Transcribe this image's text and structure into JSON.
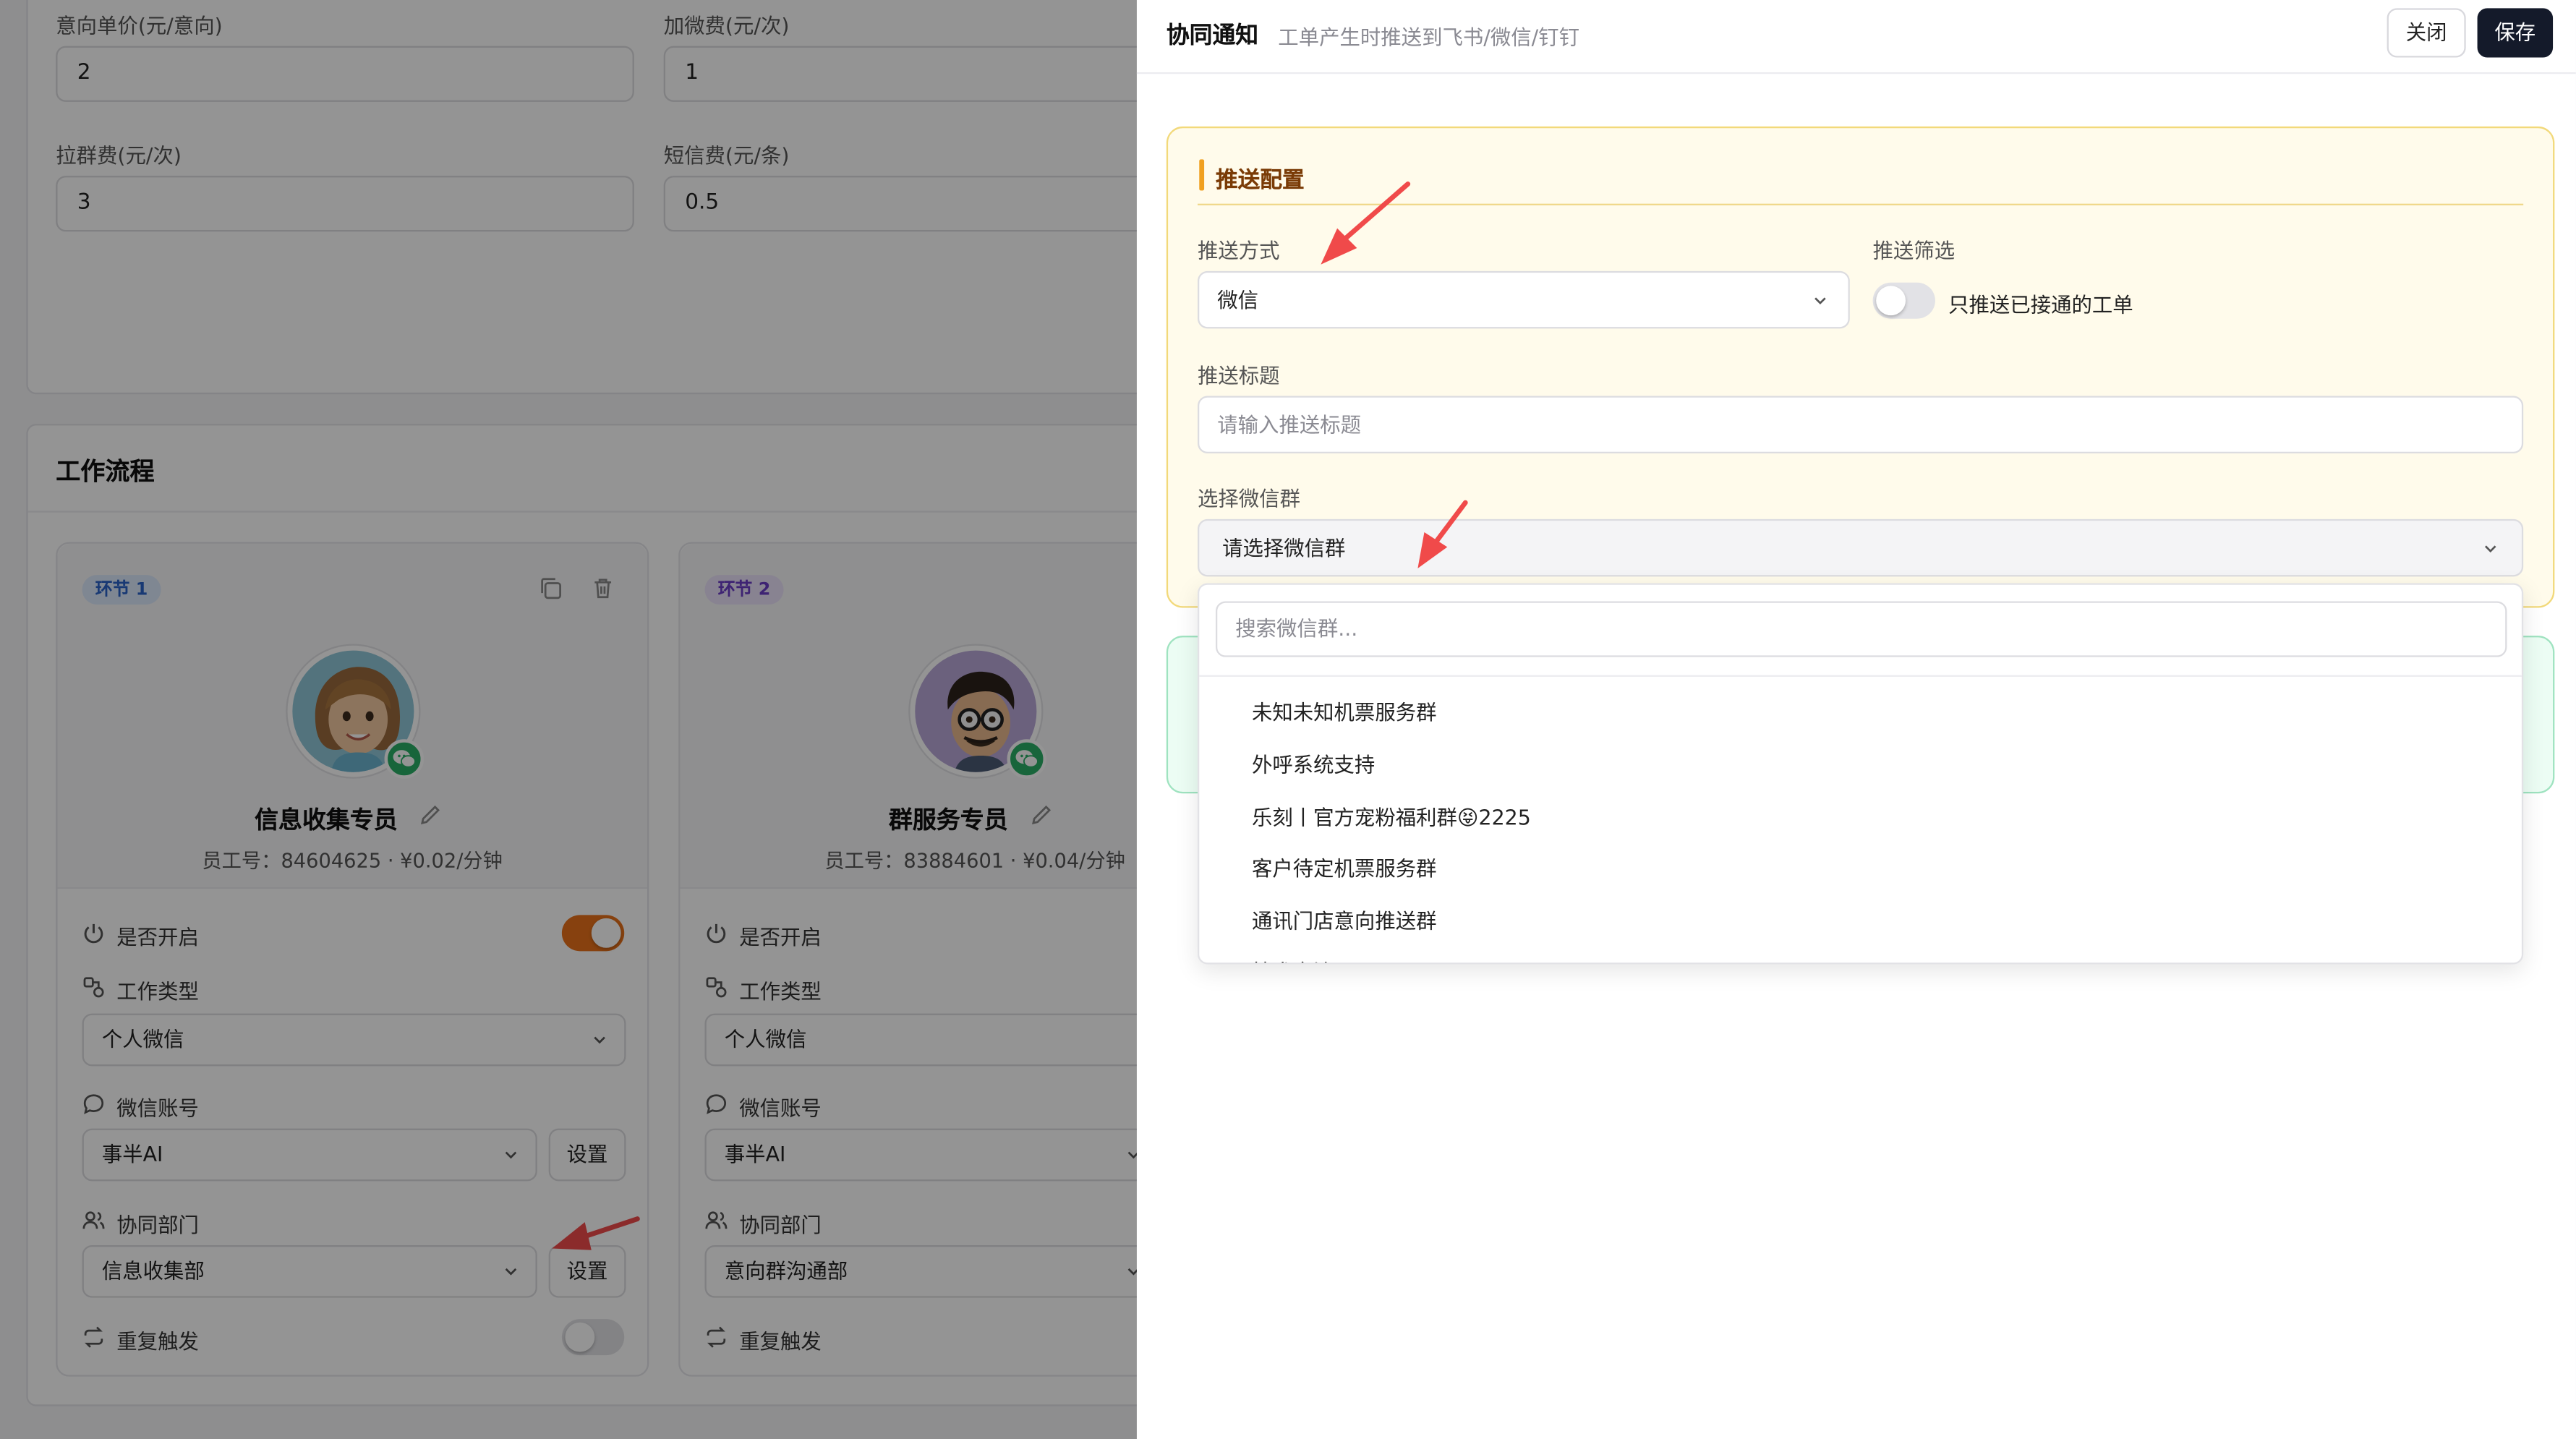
{
  "background_page": {
    "fields": [
      {
        "label": "意向单价(元/意向)",
        "value": "2"
      },
      {
        "label": "加微费(元/次)",
        "value": "1"
      },
      {
        "label": "拉群费(元/次)",
        "value": "3"
      },
      {
        "label": "短信费(元/条)",
        "value": "0.5"
      }
    ],
    "workflow_title": "工作流程",
    "stages": [
      {
        "badge": "环节 1",
        "role": "信息收集专员",
        "employee": "员工号：84604625 · ¥0.02/分钟",
        "enabled_label": "是否开启",
        "enabled": true,
        "work_type_label": "工作类型",
        "work_type": "个人微信",
        "wechat_label": "微信账号",
        "wechat": "事半AI",
        "wechat_btn": "设置",
        "dept_label": "协同部门",
        "dept": "信息收集部",
        "dept_btn": "设置",
        "repeat_label": "重复触发",
        "repeat": false
      },
      {
        "badge": "环节 2",
        "role": "群服务专员",
        "employee": "员工号：83884601 · ¥0.04/分钟",
        "enabled_label": "是否开启",
        "work_type_label": "工作类型",
        "work_type": "个人微信",
        "wechat_label": "微信账号",
        "wechat": "事半AI",
        "dept_label": "协同部门",
        "dept": "意向群沟通部",
        "repeat_label": "重复触发"
      }
    ]
  },
  "drawer": {
    "title": "协同通知",
    "subtitle": "工单产生时推送到飞书/微信/钉钉",
    "close_label": "关闭",
    "save_label": "保存",
    "push_config": {
      "title": "推送配置",
      "method_label": "推送方式",
      "method_value": "微信",
      "filter_label": "推送筛选",
      "filter_toggle_text": "只推送已接通的工单",
      "filter_enabled": false,
      "push_title_label": "推送标题",
      "push_title_placeholder": "请输入推送标题",
      "group_label": "选择微信群",
      "group_placeholder": "请选择微信群"
    },
    "dropdown": {
      "search_placeholder": "搜索微信群...",
      "options": [
        "未知未知机票服务群",
        "外呼系统支持",
        "乐刻丨官方宠粉福利群😝2225",
        "客户待定机票服务群",
        "通讯门店意向推送群",
        "技术交流"
      ]
    }
  },
  "colors": {
    "toggle_on": "#e8711a",
    "save_button": "#141a2a",
    "annotation_arrow": "#f04a4a",
    "push_panel_bg": "#fffbeb"
  }
}
